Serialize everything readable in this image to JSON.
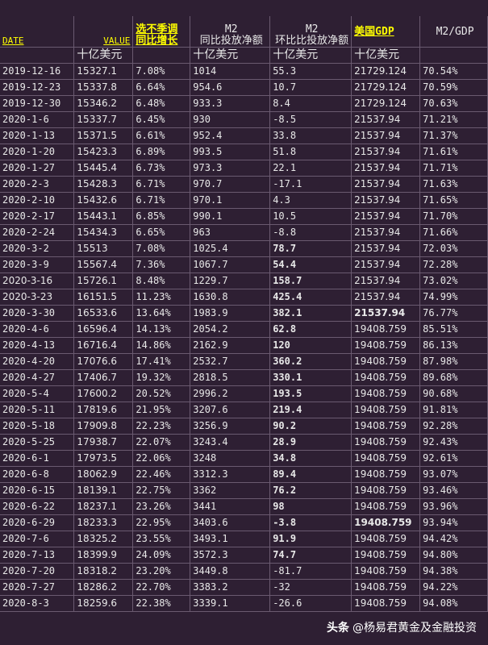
{
  "headers": {
    "date": "DATE",
    "value": "VALUE",
    "value_unit": "十亿美元",
    "yoy_line1": "选不季调",
    "yoy_line2": "同比增长",
    "m2_yoy_line1": "M2",
    "m2_yoy_line2": "同比投放净额",
    "m2_yoy_unit": "十亿美元",
    "m2_mom_line1": "M2",
    "m2_mom_line2": "环比比投放净额",
    "m2_mom_unit": "十亿美元",
    "gdp_title": "美国GDP",
    "gdp_unit": "十亿美元",
    "ratio": "M2/GDP"
  },
  "rows": [
    {
      "date": "2019-12-16",
      "value": "15327.1",
      "yoy": "7.08%",
      "m2yoy": "1014",
      "m2mom": "55.3",
      "gdp": "21729.124",
      "ratio": "70.54%"
    },
    {
      "date": "2019-12-23",
      "value": "15337.8",
      "yoy": "6.64%",
      "m2yoy": "954.6",
      "m2mom": "10.7",
      "gdp": "21729.124",
      "ratio": "70.59%"
    },
    {
      "date": "2019-12-30",
      "value": "15346.2",
      "yoy": "6.48%",
      "m2yoy": "933.3",
      "m2mom": "8.4",
      "gdp": "21729.124",
      "ratio": "70.63%"
    },
    {
      "date": "2020-1-6",
      "value": "15337.7",
      "yoy": "6.45%",
      "m2yoy": "930",
      "m2mom": "-8.5",
      "gdp": "21537.94",
      "ratio": "71.21%"
    },
    {
      "date": "2020-1-13",
      "value": "15371.5",
      "yoy": "6.61%",
      "m2yoy": "952.4",
      "m2mom": "33.8",
      "gdp": "21537.94",
      "ratio": "71.37%"
    },
    {
      "date": "2020-1-20",
      "value": "15423.3",
      "yoy": "6.89%",
      "m2yoy": "993.5",
      "m2mom": "51.8",
      "gdp": "21537.94",
      "ratio": "71.61%"
    },
    {
      "date": "2020-1-27",
      "value": "15445.4",
      "yoy": "6.73%",
      "m2yoy": "973.3",
      "m2mom": "22.1",
      "gdp": "21537.94",
      "ratio": "71.71%"
    },
    {
      "date": "2020-2-3",
      "value": "15428.3",
      "yoy": "6.71%",
      "m2yoy": "970.7",
      "m2mom": "-17.1",
      "gdp": "21537.94",
      "ratio": "71.63%"
    },
    {
      "date": "2020-2-10",
      "value": "15432.6",
      "yoy": "6.71%",
      "m2yoy": "970.1",
      "m2mom": "4.3",
      "gdp": "21537.94",
      "ratio": "71.65%"
    },
    {
      "date": "2020-2-17",
      "value": "15443.1",
      "yoy": "6.85%",
      "m2yoy": "990.1",
      "m2mom": "10.5",
      "gdp": "21537.94",
      "ratio": "71.70%"
    },
    {
      "date": "2020-2-24",
      "value": "15434.3",
      "yoy": "6.65%",
      "m2yoy": "963",
      "m2mom": "-8.8",
      "gdp": "21537.94",
      "ratio": "71.66%"
    },
    {
      "date": "2020-3-2",
      "value": "15513",
      "yoy": "7.08%",
      "m2yoy": "1025.4",
      "m2mom": "78.7",
      "gdp": "21537.94",
      "ratio": "72.03%",
      "hl": true
    },
    {
      "date": "2020-3-9",
      "value": "15567.4",
      "yoy": "7.36%",
      "m2yoy": "1067.7",
      "m2mom": "54.4",
      "gdp": "21537.94",
      "ratio": "72.28%",
      "hl": true
    },
    {
      "date": "2020-3-16",
      "value": "15726.1",
      "yoy": "8.48%",
      "m2yoy": "1229.7",
      "m2mom": "158.7",
      "gdp": "21537.94",
      "ratio": "73.02%",
      "hl": true
    },
    {
      "date": "2020-3-23",
      "value": "16151.5",
      "yoy": "11.23%",
      "m2yoy": "1630.8",
      "m2mom": "425.4",
      "gdp": "21537.94",
      "ratio": "74.99%",
      "hl": true
    },
    {
      "date": "2020-3-30",
      "value": "16533.6",
      "yoy": "13.64%",
      "m2yoy": "1983.9",
      "m2mom": "382.1",
      "gdp": "21537.94",
      "ratio": "76.77%",
      "hl": true,
      "gdpbold": true
    },
    {
      "date": "2020-4-6",
      "value": "16596.4",
      "yoy": "14.13%",
      "m2yoy": "2054.2",
      "m2mom": "62.8",
      "gdp": "19408.759",
      "ratio": "85.51%",
      "hl": true
    },
    {
      "date": "2020-4-13",
      "value": "16716.4",
      "yoy": "14.86%",
      "m2yoy": "2162.9",
      "m2mom": "120",
      "gdp": "19408.759",
      "ratio": "86.13%",
      "hl": true
    },
    {
      "date": "2020-4-20",
      "value": "17076.6",
      "yoy": "17.41%",
      "m2yoy": "2532.7",
      "m2mom": "360.2",
      "gdp": "19408.759",
      "ratio": "87.98%",
      "hl": true
    },
    {
      "date": "2020-4-27",
      "value": "17406.7",
      "yoy": "19.32%",
      "m2yoy": "2818.5",
      "m2mom": "330.1",
      "gdp": "19408.759",
      "ratio": "89.68%",
      "hl": true
    },
    {
      "date": "2020-5-4",
      "value": "17600.2",
      "yoy": "20.52%",
      "m2yoy": "2996.2",
      "m2mom": "193.5",
      "gdp": "19408.759",
      "ratio": "90.68%",
      "hl": true
    },
    {
      "date": "2020-5-11",
      "value": "17819.6",
      "yoy": "21.95%",
      "m2yoy": "3207.6",
      "m2mom": "219.4",
      "gdp": "19408.759",
      "ratio": "91.81%",
      "hl": true
    },
    {
      "date": "2020-5-18",
      "value": "17909.8",
      "yoy": "22.23%",
      "m2yoy": "3256.9",
      "m2mom": "90.2",
      "gdp": "19408.759",
      "ratio": "92.28%",
      "hl": true
    },
    {
      "date": "2020-5-25",
      "value": "17938.7",
      "yoy": "22.07%",
      "m2yoy": "3243.4",
      "m2mom": "28.9",
      "gdp": "19408.759",
      "ratio": "92.43%",
      "hl": true
    },
    {
      "date": "2020-6-1",
      "value": "17973.5",
      "yoy": "22.06%",
      "m2yoy": "3248",
      "m2mom": "34.8",
      "gdp": "19408.759",
      "ratio": "92.61%",
      "hl": true
    },
    {
      "date": "2020-6-8",
      "value": "18062.9",
      "yoy": "22.46%",
      "m2yoy": "3312.3",
      "m2mom": "89.4",
      "gdp": "19408.759",
      "ratio": "93.07%",
      "hl": true
    },
    {
      "date": "2020-6-15",
      "value": "18139.1",
      "yoy": "22.75%",
      "m2yoy": "3362",
      "m2mom": "76.2",
      "gdp": "19408.759",
      "ratio": "93.46%",
      "hl": true
    },
    {
      "date": "2020-6-22",
      "value": "18237.1",
      "yoy": "23.26%",
      "m2yoy": "3441",
      "m2mom": "98",
      "gdp": "19408.759",
      "ratio": "93.96%",
      "hl": true
    },
    {
      "date": "2020-6-29",
      "value": "18233.3",
      "yoy": "22.95%",
      "m2yoy": "3403.6",
      "m2mom": "-3.8",
      "gdp": "19408.759",
      "ratio": "93.94%",
      "hl": true,
      "gdpbold": true
    },
    {
      "date": "2020-7-6",
      "value": "18325.2",
      "yoy": "23.55%",
      "m2yoy": "3493.1",
      "m2mom": "91.9",
      "gdp": "19408.759",
      "ratio": "94.42%",
      "hl": true,
      "gdpgreen": true
    },
    {
      "date": "2020-7-13",
      "value": "18399.9",
      "yoy": "24.09%",
      "m2yoy": "3572.3",
      "m2mom": "74.7",
      "gdp": "19408.759",
      "ratio": "94.80%",
      "hl": true,
      "gdpgreen": true
    },
    {
      "date": "2020-7-20",
      "value": "18318.2",
      "yoy": "23.20%",
      "m2yoy": "3449.8",
      "m2mom": "-81.7",
      "gdp": "19408.759",
      "ratio": "94.38%",
      "gdpgreen": true
    },
    {
      "date": "2020-7-27",
      "value": "18286.2",
      "yoy": "22.70%",
      "m2yoy": "3383.2",
      "m2mom": "-32",
      "gdp": "19408.759",
      "ratio": "94.22%",
      "gdpgreen": true
    },
    {
      "date": "2020-8-3",
      "value": "18259.6",
      "yoy": "22.38%",
      "m2yoy": "3339.1",
      "m2mom": "-26.6",
      "gdp": "19408.759",
      "ratio": "94.08%",
      "gdpgreen": true
    }
  ],
  "footer": {
    "brand": "头条",
    "author": "@杨易君黄金及金融投资"
  }
}
